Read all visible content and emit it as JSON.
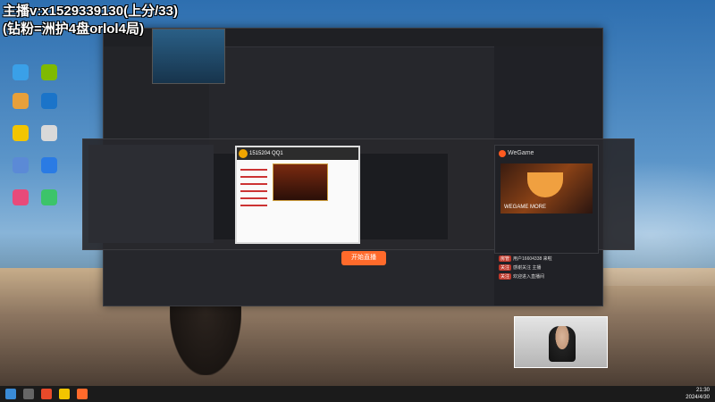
{
  "overlay": {
    "line1": "主播v:x1529339130(上分/33)",
    "line2": "(钻粉=洲护4盘orlol4局)"
  },
  "desktop_icons": [
    {
      "name": "app-icon-1",
      "color": "#3aa0e8",
      "label": ""
    },
    {
      "name": "app-icon-2",
      "color": "#7fba00",
      "label": ""
    },
    {
      "name": "app-icon-3",
      "color": "#e8a03a",
      "label": ""
    },
    {
      "name": "app-icon-4",
      "color": "#1b74c9",
      "label": ""
    },
    {
      "name": "app-icon-5",
      "color": "#f2c500",
      "label": ""
    },
    {
      "name": "app-icon-6",
      "color": "#d9d9d9",
      "label": ""
    },
    {
      "name": "app-icon-7",
      "color": "#5b8ad6",
      "label": ""
    },
    {
      "name": "app-icon-8",
      "color": "#2a7be4",
      "label": ""
    },
    {
      "name": "app-icon-9",
      "color": "#e84a7a",
      "label": ""
    },
    {
      "name": "app-icon-10",
      "color": "#3cc46a",
      "label": ""
    }
  ],
  "app": {
    "start_button": "开始直播"
  },
  "thumb": {
    "title": "1515204 QQ1"
  },
  "wegame": {
    "title": "WeGame",
    "logo_text": "WEGAME MORE"
  },
  "chat": [
    {
      "badge": "房管",
      "text": "用户16604338 来啦"
    },
    {
      "badge": "关注",
      "text": "感谢关注 主播"
    },
    {
      "badge": "关注",
      "text": "欢迎进入直播间"
    }
  ],
  "clock": {
    "time": "21:30",
    "date": "2024/4/30"
  }
}
